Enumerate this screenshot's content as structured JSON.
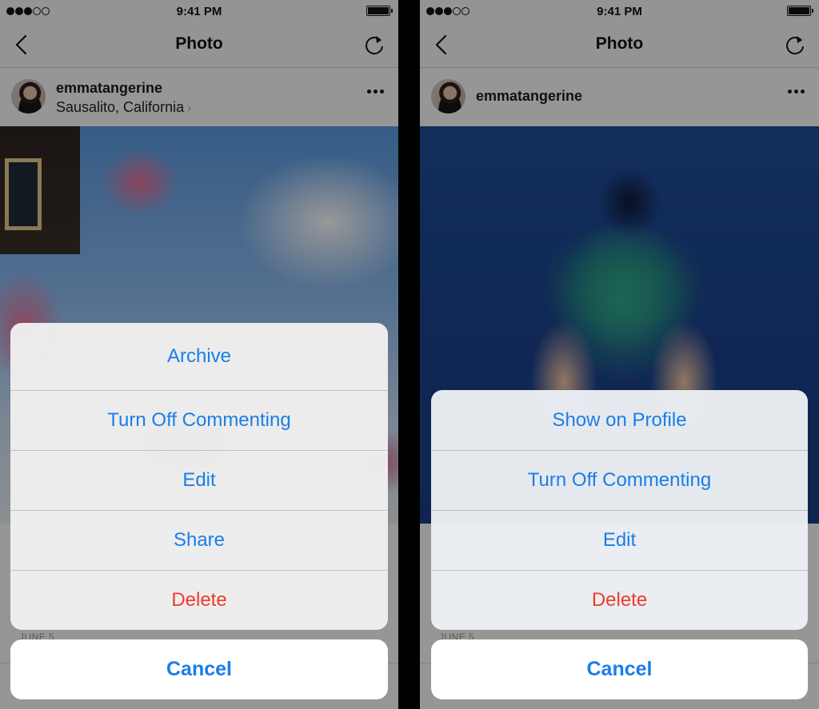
{
  "colors": {
    "accent": "#1a7ee8",
    "destructive": "#f03a2f",
    "divider": "#000000"
  },
  "screens": [
    {
      "status_bar": {
        "time": "9:41 PM",
        "signal_bars_filled": 3,
        "signal_bars_total": 5,
        "battery_percent": 100
      },
      "nav": {
        "title": "Photo",
        "back_icon": "chevron-left-icon",
        "refresh_icon": "refresh-icon"
      },
      "post": {
        "username": "emmatangerine",
        "location": "Sausalito, California",
        "location_chevron": "›",
        "more_icon": "more-horizontal-icon",
        "photo_description": "Pink cherry blossoms against a blue sky",
        "date": "JUNE 5"
      },
      "action_sheet": {
        "items": [
          {
            "label": "Archive",
            "style": "default"
          },
          {
            "label": "Turn Off Commenting",
            "style": "default"
          },
          {
            "label": "Edit",
            "style": "default"
          },
          {
            "label": "Share",
            "style": "default"
          },
          {
            "label": "Delete",
            "style": "destructive"
          }
        ],
        "cancel_label": "Cancel"
      }
    },
    {
      "status_bar": {
        "time": "9:41 PM",
        "signal_bars_filled": 3,
        "signal_bars_total": 5,
        "battery_percent": 100
      },
      "nav": {
        "title": "Photo",
        "back_icon": "chevron-left-icon",
        "refresh_icon": "refresh-icon"
      },
      "post": {
        "username": "emmatangerine",
        "more_icon": "more-horizontal-icon",
        "photo_description": "Person holding a monstera leaf in front of a blue wall",
        "date": "JUNE 5"
      },
      "action_sheet": {
        "items": [
          {
            "label": "Show on Profile",
            "style": "default"
          },
          {
            "label": "Turn Off Commenting",
            "style": "default"
          },
          {
            "label": "Edit",
            "style": "default"
          },
          {
            "label": "Delete",
            "style": "destructive"
          }
        ],
        "cancel_label": "Cancel"
      }
    }
  ]
}
